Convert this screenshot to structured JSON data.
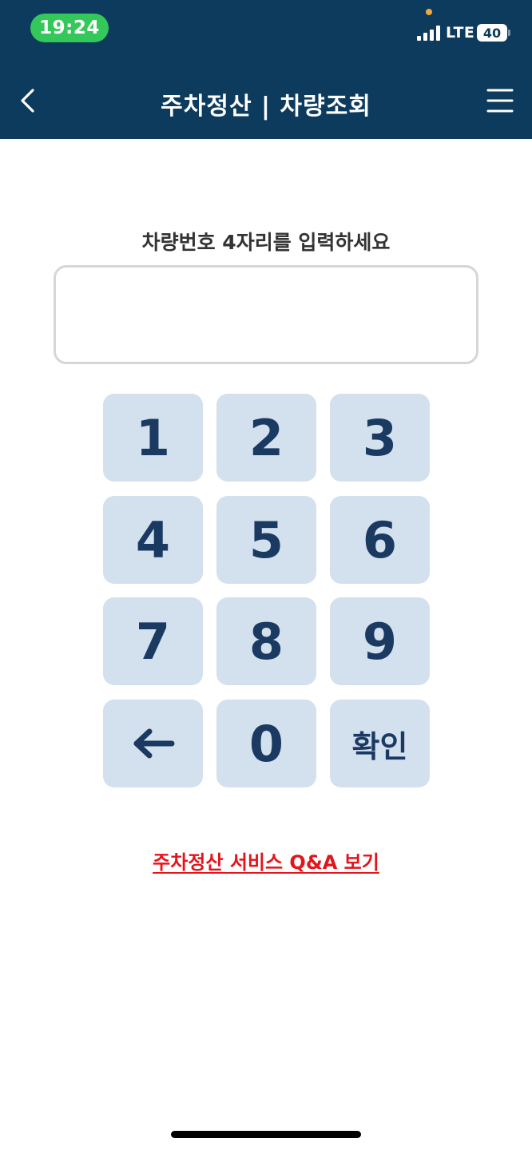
{
  "status_bar": {
    "time": "19:24",
    "network": "LTE",
    "battery": "40"
  },
  "nav": {
    "title": "주차정산 | 차량조회",
    "back_icon": "chevron-left-icon",
    "menu_icon": "hamburger-menu-icon"
  },
  "main": {
    "prompt": "차량번호 4자리를 입력하세요",
    "plate_value": "",
    "plate_placeholder": ""
  },
  "keypad": {
    "keys": [
      "1",
      "2",
      "3",
      "4",
      "5",
      "6",
      "7",
      "8",
      "9",
      "←",
      "0",
      "확인"
    ]
  },
  "qa_link": "주차정산 서비스 Q&A 보기",
  "colors": {
    "header_bg": "#0d3b5e",
    "key_bg": "#d3e0ee",
    "key_text": "#1b3a62",
    "link": "#e5141b",
    "time_pill": "#34c759"
  }
}
